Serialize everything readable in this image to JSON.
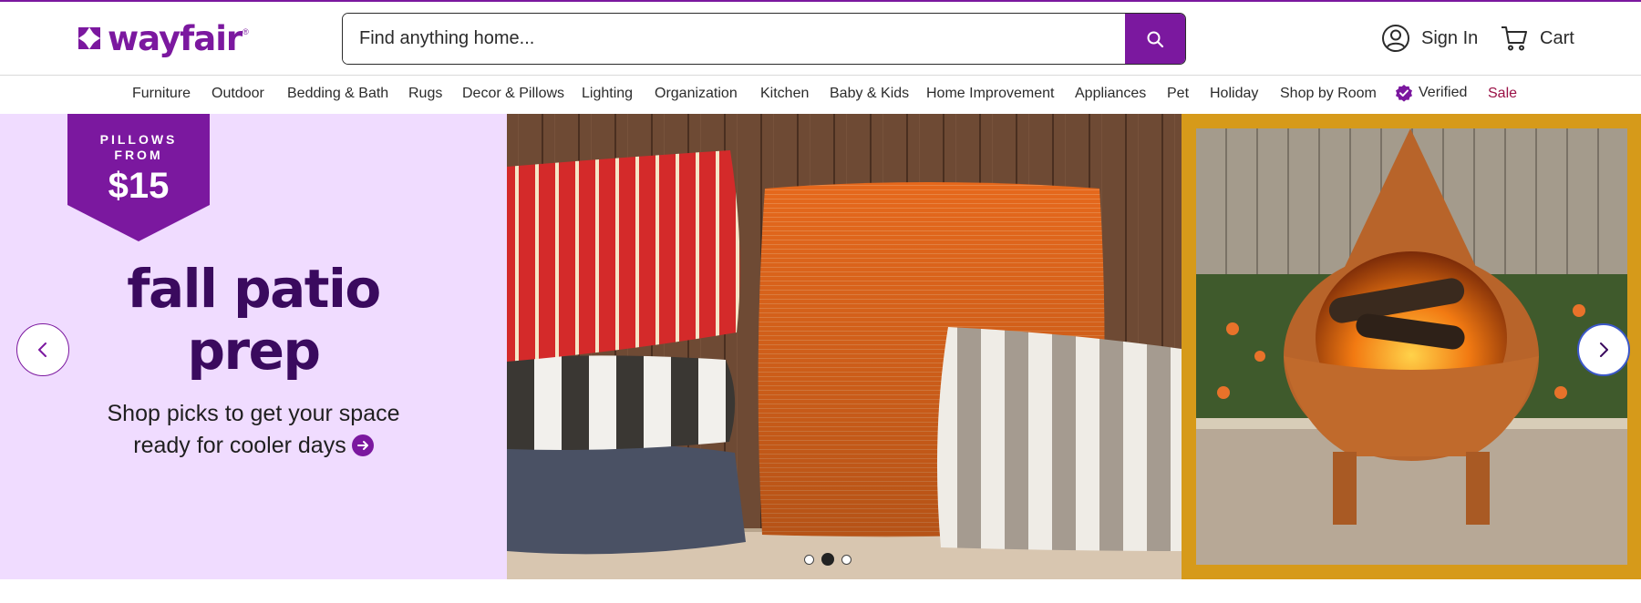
{
  "header": {
    "logo_text": "wayfair",
    "logo_tm": "®",
    "search_placeholder": "Find anything home...",
    "sign_in_label": "Sign In",
    "cart_label": "Cart"
  },
  "nav": {
    "items": [
      "Furniture",
      "Outdoor",
      "Bedding & Bath",
      "Rugs",
      "Decor & Pillows",
      "Lighting",
      "Organization",
      "Kitchen",
      "Baby & Kids",
      "Home Improvement",
      "Appliances",
      "Pet",
      "Holiday",
      "Shop by Room"
    ],
    "verified_label": "Verified",
    "sale_label": "Sale"
  },
  "hero": {
    "badge_line1": "PILLOWS",
    "badge_line2": "FROM",
    "badge_price": "$15",
    "headline_line1": "fall patio",
    "headline_line2": "prep",
    "subtext_line1": "Shop picks to get your space",
    "subtext_line2": "ready for cooler days",
    "carousel_dots": 3,
    "active_dot": 2
  },
  "colors": {
    "brand": "#7b189f",
    "headline": "#3a0a5e",
    "promo_bg": "#f0dcff",
    "sale": "#9a1146",
    "frame": "#d69a1a"
  },
  "icons": [
    "logo-mark-icon",
    "search-icon",
    "user-icon",
    "cart-icon",
    "verified-badge-icon",
    "arrow-right-icon",
    "chevron-left-icon",
    "chevron-right-icon"
  ]
}
